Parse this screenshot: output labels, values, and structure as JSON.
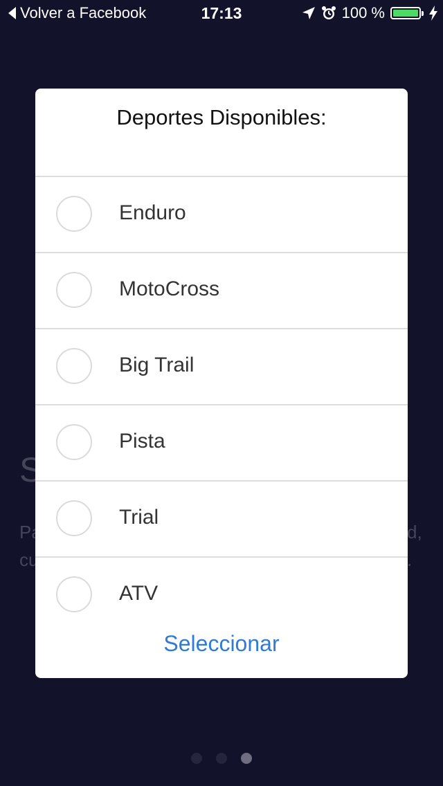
{
  "status_bar": {
    "back_label": "Volver a Facebook",
    "time": "17:13",
    "battery_percent": "100 %",
    "battery_level": 1.0,
    "icons": [
      "back-chevron-icon",
      "location-arrow-icon",
      "alarm-clock-icon",
      "battery-icon",
      "charging-bolt-icon"
    ]
  },
  "background": {
    "heading_fragment": "S",
    "line1_start": "Pa",
    "line2_start": "cu",
    "line1_end": "d,",
    "line2_end": "."
  },
  "dialog": {
    "title": "Deportes Disponibles:",
    "options": [
      {
        "label": "Enduro",
        "selected": false
      },
      {
        "label": "MotoCross",
        "selected": false
      },
      {
        "label": "Big Trail",
        "selected": false
      },
      {
        "label": "Pista",
        "selected": false
      },
      {
        "label": "Trial",
        "selected": false
      },
      {
        "label": "ATV",
        "selected": false
      }
    ],
    "confirm_label": "Seleccionar"
  },
  "pager": {
    "count": 3,
    "active_index": 2
  },
  "colors": {
    "background": "#13122b",
    "accent": "#2f7bd6",
    "battery": "#4cd964"
  }
}
